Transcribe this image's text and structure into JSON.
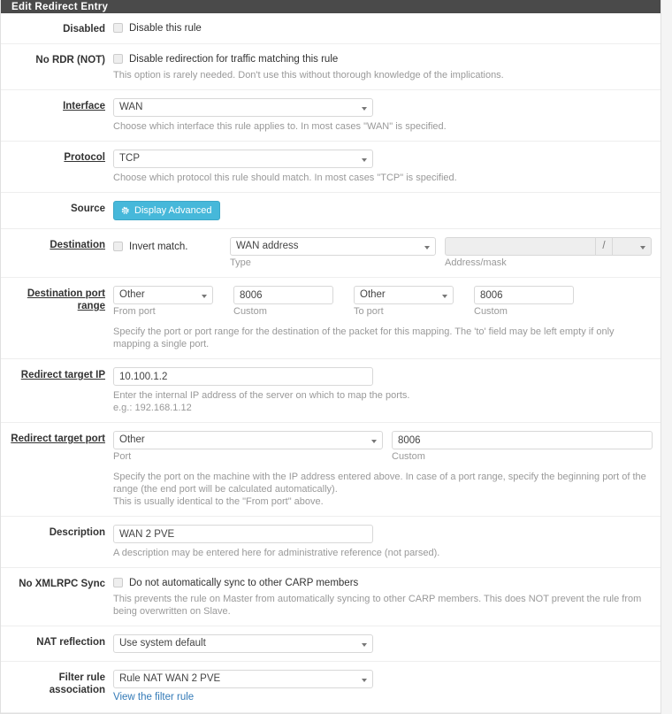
{
  "panel": {
    "title": "Edit Redirect Entry"
  },
  "rows": {
    "disabled": {
      "label": "Disabled",
      "checkbox_label": "Disable this rule"
    },
    "no_rdr": {
      "label": "No RDR (NOT)",
      "checkbox_label": "Disable redirection for traffic matching this rule",
      "help": "This option is rarely needed. Don't use this without thorough knowledge of the implications."
    },
    "interface": {
      "label": "Interface",
      "value": "WAN",
      "help": "Choose which interface this rule applies to. In most cases \"WAN\" is specified."
    },
    "protocol": {
      "label": "Protocol",
      "value": "TCP",
      "help": "Choose which protocol this rule should match. In most cases \"TCP\" is specified."
    },
    "source": {
      "label": "Source",
      "button_label": "Display Advanced",
      "button_icon": "gear-icon",
      "button_color": "#46b8da"
    },
    "destination": {
      "label": "Destination",
      "invert_label": "Invert match.",
      "type_value": "WAN address",
      "type_sublabel": "Type",
      "address_value": "",
      "slash": "/",
      "mask_value": "",
      "address_sublabel": "Address/mask"
    },
    "dest_port_range": {
      "label": "Destination port range",
      "from_port_value": "Other",
      "from_port_sublabel": "From port",
      "from_custom_value": "8006",
      "from_custom_sublabel": "Custom",
      "to_port_value": "Other",
      "to_port_sublabel": "To port",
      "to_custom_value": "8006",
      "to_custom_sublabel": "Custom",
      "help": "Specify the port or port range for the destination of the packet for this mapping. The 'to' field may be left empty if only mapping a single port."
    },
    "redirect_target_ip": {
      "label": "Redirect target IP",
      "value": "10.100.1.2",
      "help_line1": "Enter the internal IP address of the server on which to map the ports.",
      "help_line2": "e.g.: 192.168.1.12"
    },
    "redirect_target_port": {
      "label": "Redirect target port",
      "port_value": "Other",
      "port_sublabel": "Port",
      "custom_value": "8006",
      "custom_sublabel": "Custom",
      "help_line1": "Specify the port on the machine with the IP address entered above. In case of a port range, specify the beginning port of the range (the end port will be calculated automatically).",
      "help_line2": "This is usually identical to the \"From port\" above."
    },
    "description": {
      "label": "Description",
      "value": "WAN 2 PVE",
      "help": "A description may be entered here for administrative reference (not parsed)."
    },
    "no_xmlrpc_sync": {
      "label": "No XMLRPC Sync",
      "checkbox_label": "Do not automatically sync to other CARP members",
      "help": "This prevents the rule on Master from automatically syncing to other CARP members. This does NOT prevent the rule from being overwritten on Slave."
    },
    "nat_reflection": {
      "label": "NAT reflection",
      "value": "Use system default"
    },
    "filter_rule_association": {
      "label": "Filter rule association",
      "value": "Rule NAT WAN 2 PVE",
      "link_text": "View the filter rule"
    }
  }
}
